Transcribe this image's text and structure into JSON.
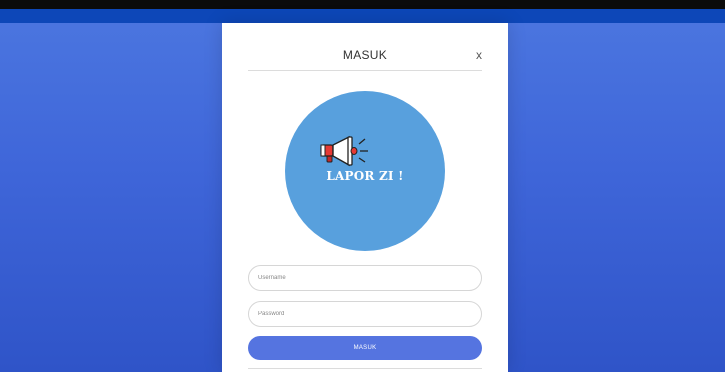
{
  "modal": {
    "title": "MASUK",
    "close_label": "x"
  },
  "logo": {
    "text": "LAPOR ZI !",
    "icon": "megaphone-icon",
    "circle_color": "#58a0dd"
  },
  "form": {
    "username_placeholder": "Username",
    "password_placeholder": "Password",
    "submit_label": "MASUK"
  },
  "colors": {
    "background": "#3f66d9",
    "top_bar": "#0d47b8",
    "button": "#5574e0"
  }
}
